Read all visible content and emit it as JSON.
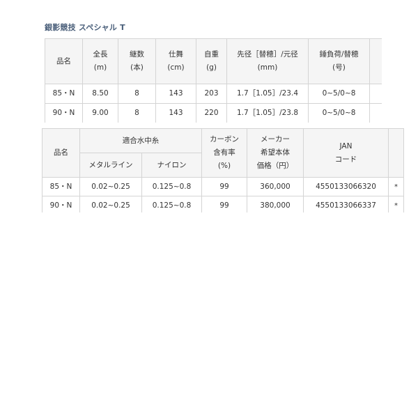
{
  "title": "銀影競技 スペシャル T",
  "table1": {
    "headers": [
      {
        "line1": "品名",
        "line2": ""
      },
      {
        "line1": "全長",
        "line2": "(m)"
      },
      {
        "line1": "継数",
        "line2": "(本)"
      },
      {
        "line1": "仕舞",
        "line2": "(cm)"
      },
      {
        "line1": "自重",
        "line2": "(g)"
      },
      {
        "line1": "先径［替穂］/元径",
        "line2": "(mm)"
      },
      {
        "line1": "錘負荷/替穂",
        "line2": "(号)"
      },
      {
        "line1": "",
        "line2": ""
      }
    ],
    "rows": [
      [
        "85・N",
        "8.50",
        "8",
        "143",
        "203",
        "1.7［1.05］/23.4",
        "0~5/0~8",
        ""
      ],
      [
        "90・N",
        "9.00",
        "8",
        "143",
        "220",
        "1.7［1.05］/23.8",
        "0~5/0~8",
        ""
      ]
    ]
  },
  "table2": {
    "header": {
      "name": "品名",
      "line_group": "適合水中糸",
      "metal": "メタルライン",
      "nylon": "ナイロン",
      "carbon_1": "カーボン",
      "carbon_2": "含有率",
      "carbon_3": "(%)",
      "price_1": "メーカー",
      "price_2": "希望本体",
      "price_3": "価格（円）",
      "jan_1": "JAN",
      "jan_2": "コード",
      "extra": ""
    },
    "rows": [
      [
        "85・N",
        "0.02~0.25",
        "0.125~0.8",
        "99",
        "360,000",
        "4550133066320",
        "*"
      ],
      [
        "90・N",
        "0.02~0.25",
        "0.125~0.8",
        "99",
        "380,000",
        "4550133066337",
        "*"
      ]
    ]
  }
}
